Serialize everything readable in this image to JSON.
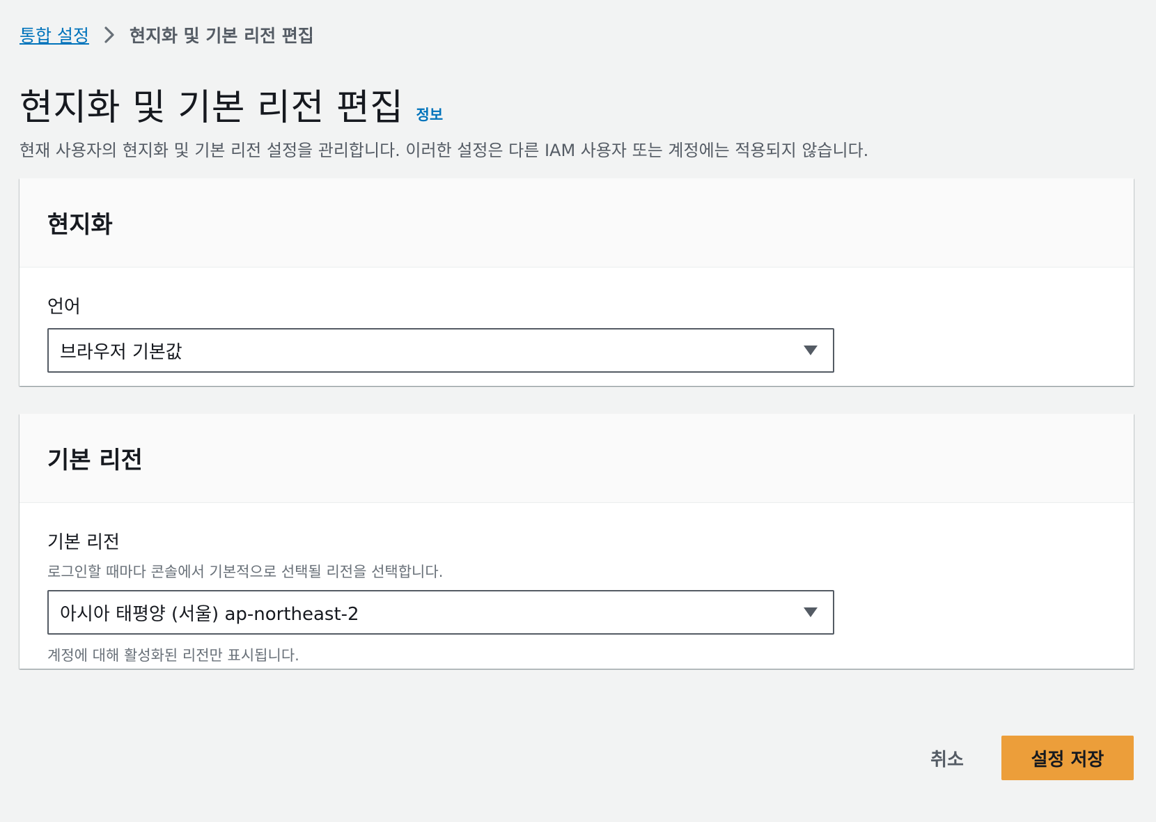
{
  "breadcrumb": {
    "parent": "통합 설정",
    "current": "현지화 및 기본 리전 편집",
    "separator_icon": "chevron-right-icon"
  },
  "header": {
    "title": "현지화 및 기본 리전 편집",
    "info_link": "정보",
    "description": "현재 사용자의 현지화 및 기본 리전 설정을 관리합니다. 이러한 설정은 다른 IAM 사용자 또는 계정에는 적용되지 않습니다."
  },
  "localization": {
    "title": "현지화",
    "language_label": "언어",
    "language_value": "브라우저 기본값"
  },
  "region": {
    "title": "기본 리전",
    "region_label": "기본 리전",
    "region_description": "로그인할 때마다 콘솔에서 기본적으로 선택될 리전을 선택합니다.",
    "region_value": "아시아 태평양 (서울) ap-northeast-2",
    "region_constraint": "계정에 대해 활성화된 리전만 표시됩니다."
  },
  "actions": {
    "cancel": "취소",
    "save": "설정 저장"
  },
  "colors": {
    "link": "#0073bb",
    "primary_button": "#ec9e3a",
    "background": "#f2f3f3"
  }
}
